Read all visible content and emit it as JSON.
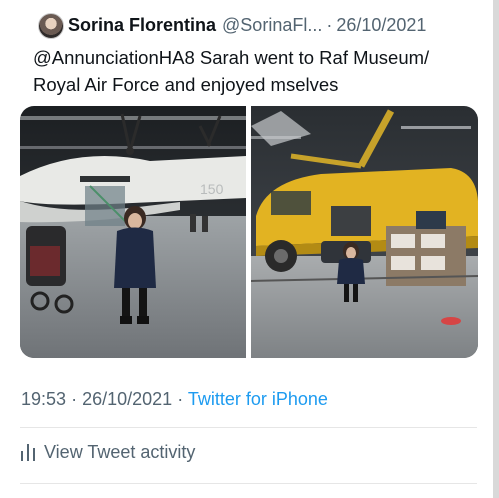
{
  "tweet": {
    "display_name": "Sorina Florentina",
    "handle": "@SorinaFl...",
    "separator": "·",
    "date": "26/10/2021",
    "text_mention": "@AnnunciationHA8",
    "text_body": " Sarah went to Raf Museum/\nRoyal Air Force and  enjoyed  mselves",
    "media": [
      {
        "description_icon": "photo-hangar-aircraft"
      },
      {
        "description_icon": "photo-yellow-helicopter"
      }
    ],
    "time": "19:53",
    "full_date": "26/10/2021",
    "client": "Twitter for iPhone",
    "activity_label": "View Tweet activity"
  },
  "colors": {
    "link": "#1d9bf0",
    "muted": "#536471",
    "text": "#0f1419"
  },
  "icons": [
    "avatar",
    "bar-chart-icon"
  ]
}
